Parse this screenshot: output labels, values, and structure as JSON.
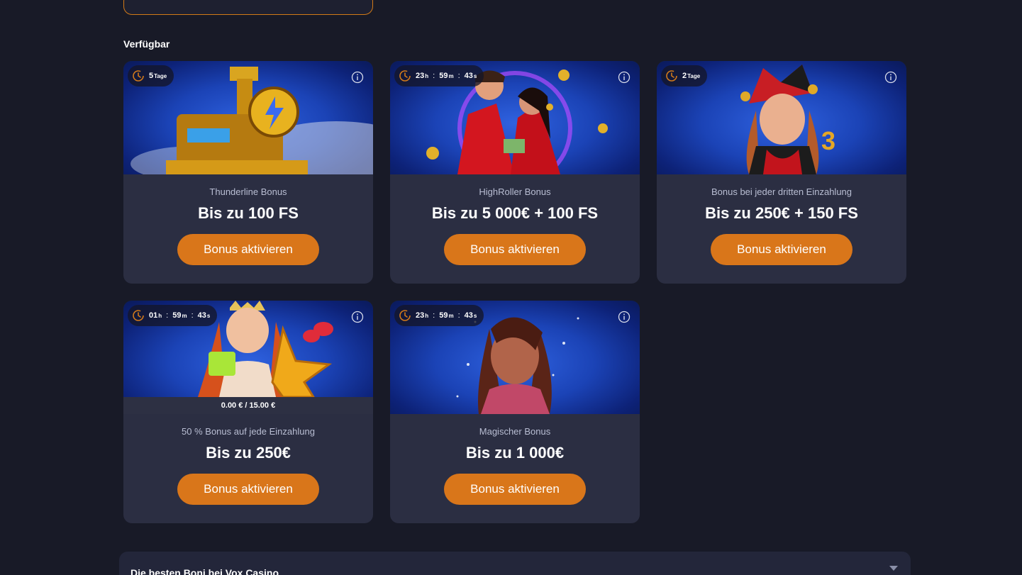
{
  "section_title": "Verfügbar",
  "footer": {
    "title": "Die besten Boni bei Vox Casino"
  },
  "cards": [
    {
      "timer": {
        "parts": [
          [
            "5",
            "Tage"
          ]
        ]
      },
      "subtitle": "Thunderline Bonus",
      "amount": "Bis zu 100 FS",
      "button": "Bonus aktivieren",
      "art": "train"
    },
    {
      "timer": {
        "parts": [
          [
            "23",
            "h"
          ],
          [
            "59",
            "m"
          ],
          [
            "43",
            "s"
          ]
        ]
      },
      "subtitle": "HighRoller Bonus",
      "amount": "Bis zu 5 000€ + 100 FS",
      "button": "Bonus aktivieren",
      "art": "couple"
    },
    {
      "timer": {
        "parts": [
          [
            "2",
            "Tage"
          ]
        ]
      },
      "subtitle": "Bonus bei jeder dritten Einzahlung",
      "amount": "Bis zu 250€ + 150 FS",
      "button": "Bonus aktivieren",
      "art": "jester"
    },
    {
      "timer": {
        "parts": [
          [
            "01",
            "h"
          ],
          [
            "59",
            "m"
          ],
          [
            "43",
            "s"
          ]
        ]
      },
      "subtitle": "50 % Bonus auf jede Einzahlung",
      "amount": "Bis zu 250€",
      "button": "Bonus aktivieren",
      "progress": "0.00 € / 15.00 €",
      "art": "queen"
    },
    {
      "timer": {
        "parts": [
          [
            "23",
            "h"
          ],
          [
            "59",
            "m"
          ],
          [
            "43",
            "s"
          ]
        ]
      },
      "subtitle": "Magischer Bonus",
      "amount": "Bis zu 1 000€",
      "button": "Bonus aktivieren",
      "art": "magic"
    }
  ],
  "colors": {
    "accent": "#d9761a",
    "card_bg": "#2b2e42",
    "page_bg": "#181a27"
  }
}
